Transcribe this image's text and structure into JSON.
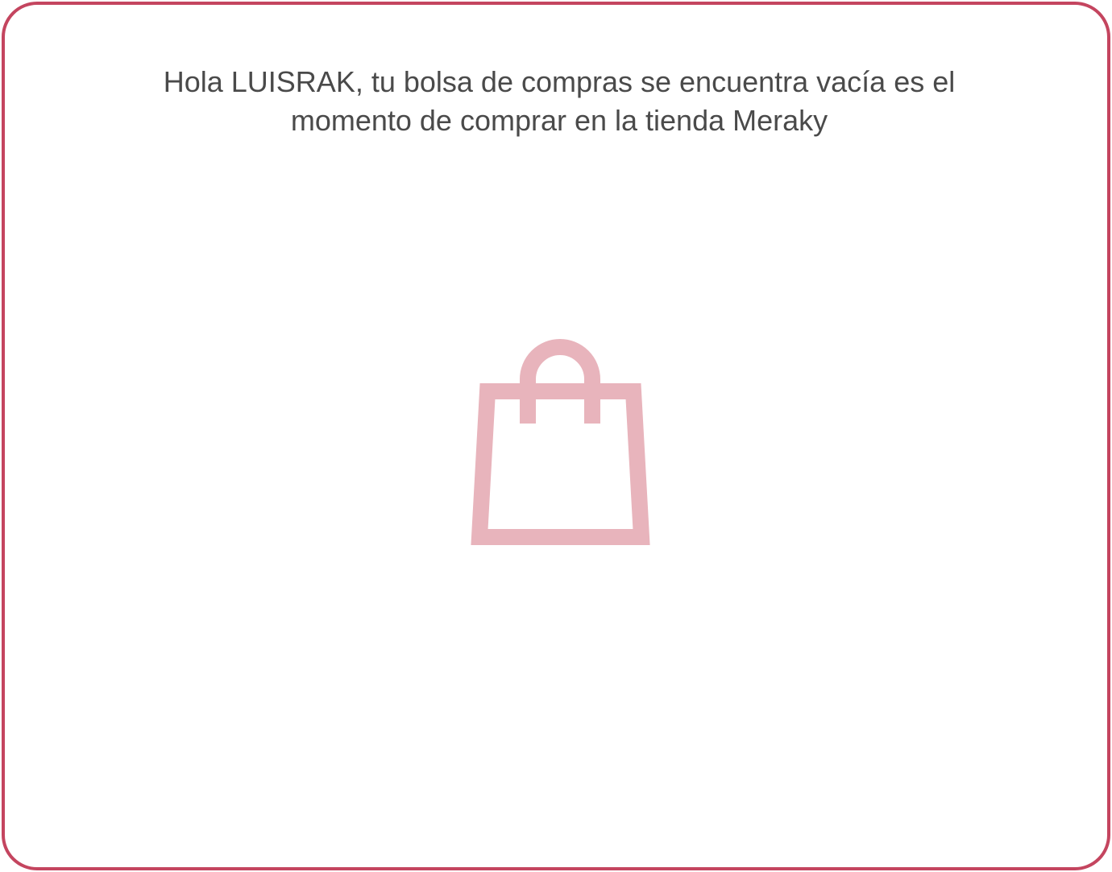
{
  "empty_cart": {
    "message": "Hola LUISRAK, tu bolsa de compras se encuentra vacía es el momento de comprar en la tienda Meraky",
    "icon": "shopping-bag-icon"
  },
  "colors": {
    "border": "#c4455f",
    "icon": "#e8b4bc",
    "text": "#4a4a4a",
    "background": "#ffffff"
  }
}
